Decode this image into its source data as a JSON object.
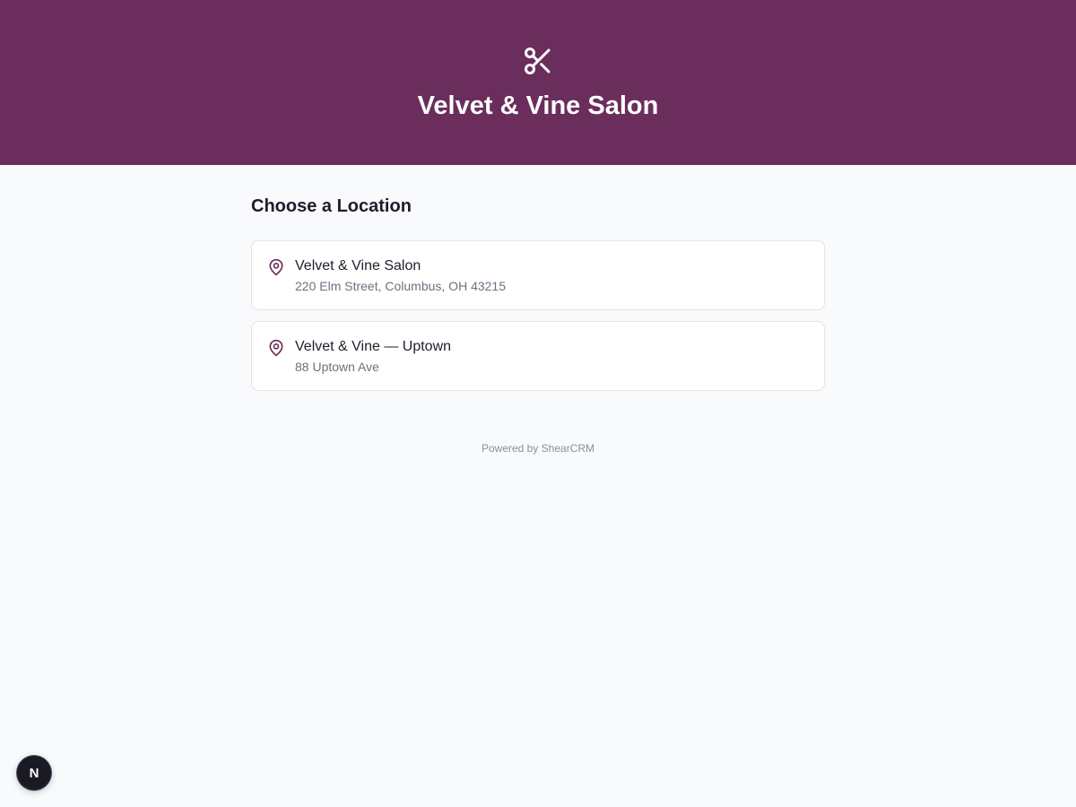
{
  "header": {
    "title": "Velvet & Vine Salon",
    "icon": "scissors-icon",
    "background_color": "#6b2d5c"
  },
  "main": {
    "heading": "Choose a Location",
    "locations": [
      {
        "name": "Velvet & Vine Salon",
        "address": "220 Elm Street, Columbus, OH 43215",
        "icon": "map-pin-icon"
      },
      {
        "name": "Velvet & Vine — Uptown",
        "address": "88 Uptown Ave",
        "icon": "map-pin-icon"
      }
    ]
  },
  "footer": {
    "text": "Powered by ShearCRM"
  },
  "dev_badge": {
    "label": "N"
  }
}
